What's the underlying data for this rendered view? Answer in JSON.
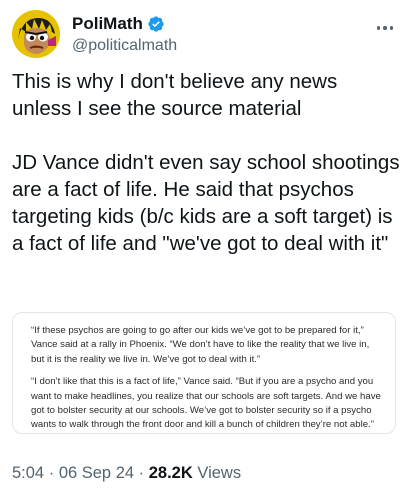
{
  "author": {
    "display_name": "PoliMath",
    "handle": "@politicalmath",
    "verified": true,
    "avatar_icon": "cartoon-avatar-icon",
    "verified_icon": "verified-badge-icon",
    "accent_color": "#1d9bf0"
  },
  "tweet": {
    "text": "This is why I don't believe any news unless I see the source material\n\nJD Vance didn't even say school shootings are a fact of life. He said that psychos targeting kids (b/c kids are a soft target) is a fact of life and \"we've got to deal with it\""
  },
  "quote": {
    "paragraph_1": "“If these psychos are going to go after our kids we’ve got to be prepared for it,” Vance said at a rally in Phoenix. “We don’t have to like the reality that we live in, but it is the reality we live in. We’ve got to deal with it.”",
    "paragraph_2": "“I don’t like that this is a fact of life,” Vance said. “But if you are a psycho and you want to make headlines, you realize that our schools are soft targets. And we have got to bolster security at our schools. We’ve got to bolster security so if a psycho wants to walk through the front door and kill a bunch of children they’re not able.”"
  },
  "meta": {
    "time": "5:04",
    "date": "06 Sep 24",
    "views_count": "28.2K",
    "views_label": "Views",
    "separator": "·"
  }
}
